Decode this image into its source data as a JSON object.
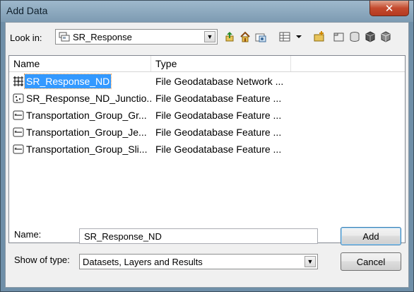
{
  "window": {
    "title": "Add Data",
    "close_glyph": "✕"
  },
  "look_in": {
    "label": "Look in:",
    "value": "SR_Response"
  },
  "list": {
    "columns": [
      "Name",
      "Type"
    ],
    "rows": [
      {
        "name": "SR_Response_ND",
        "type": "File Geodatabase Network ...",
        "icon": "network-dataset-icon",
        "selected": true
      },
      {
        "name": "SR_Response_ND_Junctio...",
        "type": "File Geodatabase Feature ...",
        "icon": "point-feature-class-icon",
        "selected": false
      },
      {
        "name": "Transportation_Group_Gr...",
        "type": "File Geodatabase Feature ...",
        "icon": "line-feature-class-icon",
        "selected": false
      },
      {
        "name": "Transportation_Group_Je...",
        "type": "File Geodatabase Feature ...",
        "icon": "line-feature-class-icon",
        "selected": false
      },
      {
        "name": "Transportation_Group_Sli...",
        "type": "File Geodatabase Feature ...",
        "icon": "line-feature-class-icon",
        "selected": false
      }
    ]
  },
  "name_field": {
    "label": "Name:",
    "value": "SR_Response_ND"
  },
  "type_field": {
    "label": "Show of type:",
    "value": "Datasets, Layers and Results"
  },
  "buttons": {
    "add": "Add",
    "cancel": "Cancel"
  },
  "colors": {
    "selection": "#3399ff",
    "title_bar": "#8aa6bc"
  }
}
